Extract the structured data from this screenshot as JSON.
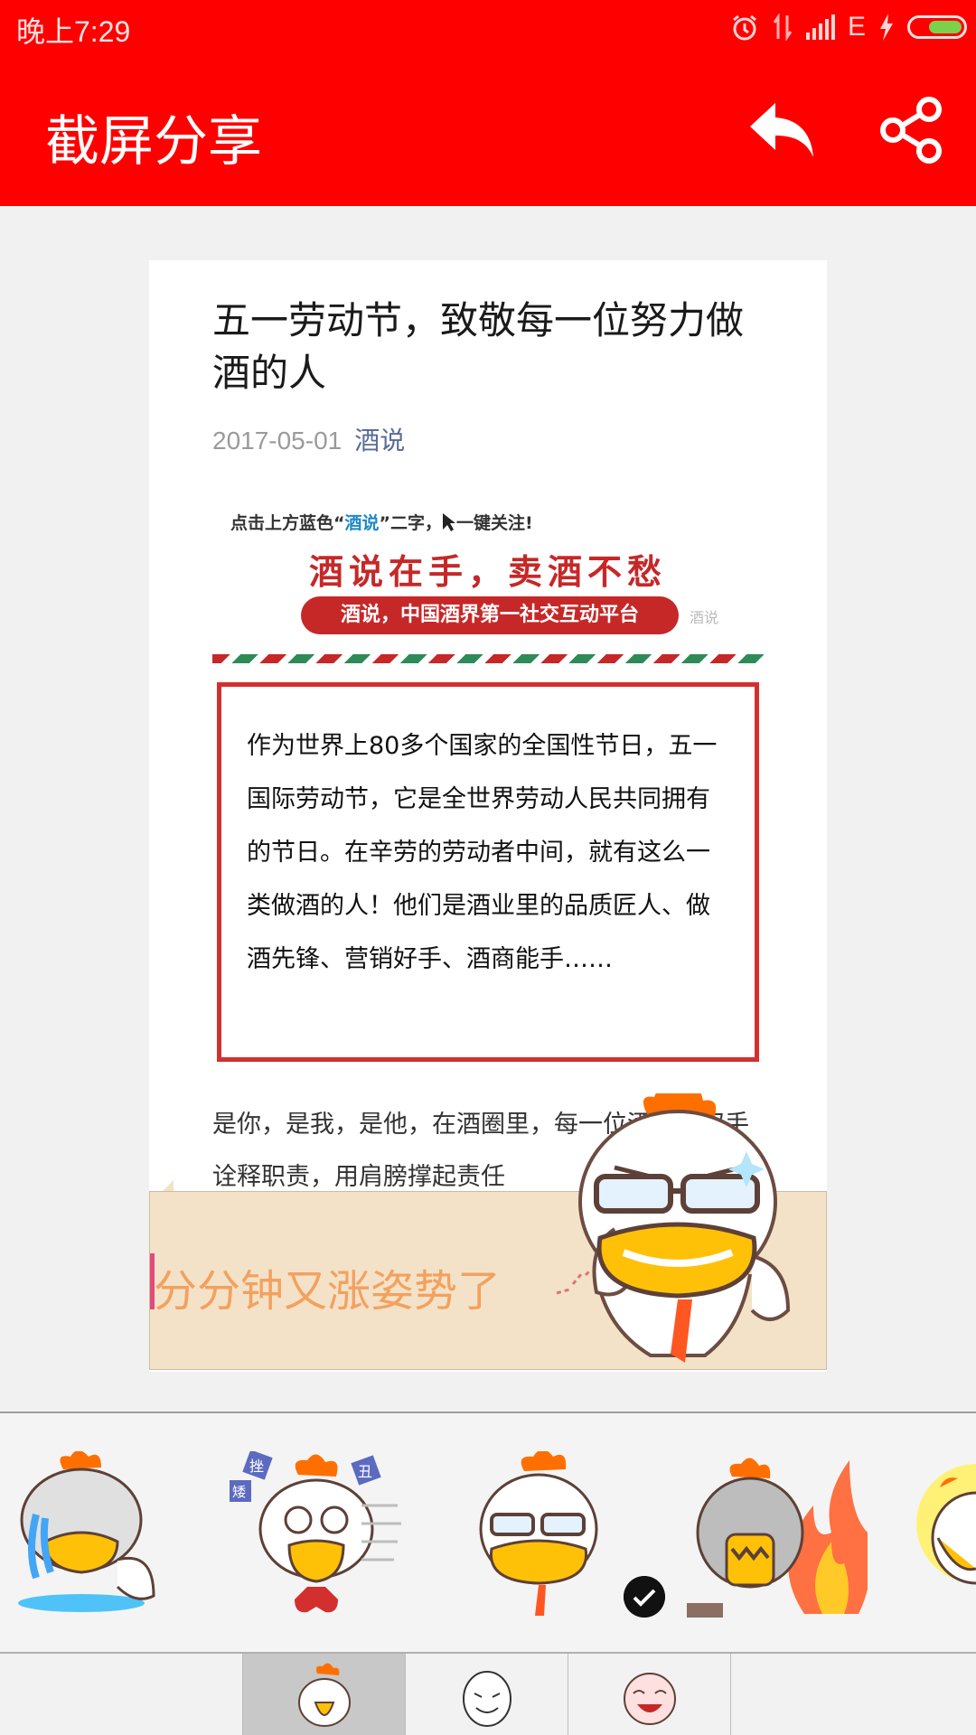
{
  "status_bar": {
    "time": "晚上7:29",
    "network": "E"
  },
  "app_bar": {
    "title": "截屏分享"
  },
  "article": {
    "title": "五一劳动节，致敬每一位努力做酒的人",
    "date": "2017-05-01",
    "source": "酒说",
    "banner": {
      "tip_prefix": "点击上方蓝色“",
      "tip_highlight": "酒说",
      "tip_suffix": "”二字，",
      "tip_action": "一键关注!",
      "slogan": "酒说在手，卖酒不愁",
      "pill": "酒说，中国酒界第一社交互动平台",
      "watermark": "酒说"
    },
    "quote": "作为世界上80多个国家的全国性节日，五一国际劳动节，它是全世界劳动人民共同拥有的节日。在辛劳的劳动者中间，就有这么一类做酒的人！他们是酒业里的品质匠人、做酒先锋、营销好手、酒商能手……",
    "body": "是你，是我，是他，在酒圈里，每一位酒人用双手诠释职责，用肩膀撑起责任"
  },
  "overlay": {
    "caption": "分分钟又涨姿势了"
  },
  "sticker_strip": {
    "stickers": [
      "crying-chicken-sticker",
      "heartbroken-chicken-sticker",
      "glasses-chicken-sticker",
      "angry-fire-chicken-sticker",
      "dancing-chicken-sticker"
    ],
    "selected_index": 2,
    "small_labels": [
      "挫",
      "丑",
      "矮"
    ]
  },
  "tabs": {
    "items": [
      "chicken-pack-tab",
      "egg-pack-tab",
      "face-pack-tab"
    ],
    "selected_index": 0
  },
  "colors": {
    "app_bar": "#ff0000",
    "caption": "#f3a15f",
    "quote_border": "#d32f2f",
    "overlay_bg": "#f3e2c8"
  }
}
